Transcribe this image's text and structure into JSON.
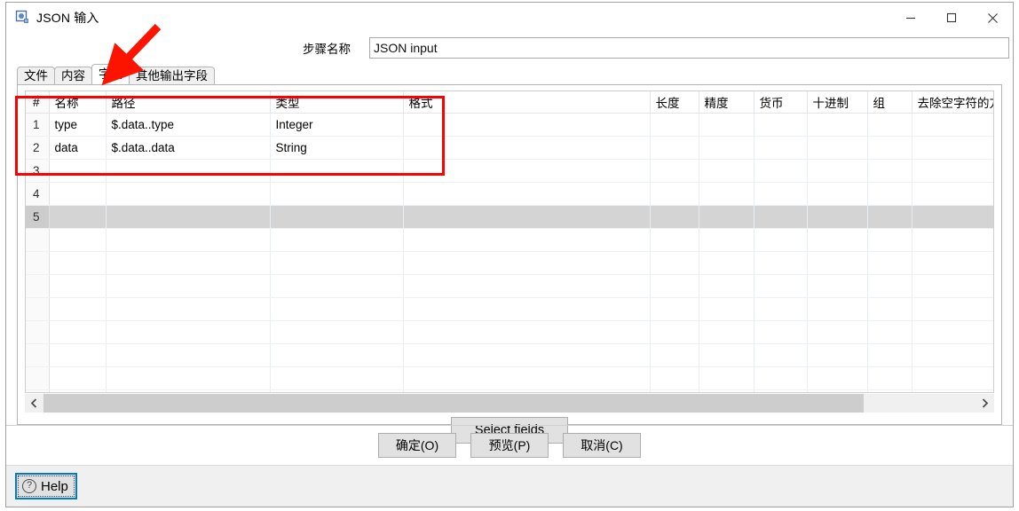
{
  "window": {
    "title": "JSON 输入",
    "icon": "json-input-app-icon",
    "controls": {
      "minimize": "minimize-icon",
      "maximize": "maximize-icon",
      "close": "close-icon"
    }
  },
  "step": {
    "label": "步骤名称",
    "value": "JSON input",
    "placeholder": ""
  },
  "tabs": [
    {
      "label": "文件",
      "active": false
    },
    {
      "label": "内容",
      "active": false
    },
    {
      "label": "字段",
      "active": true
    },
    {
      "label": "其他输出字段",
      "active": false
    }
  ],
  "grid": {
    "columns": [
      {
        "label": "#",
        "key": "idx"
      },
      {
        "label": "名称",
        "key": "name"
      },
      {
        "label": "路径",
        "key": "path"
      },
      {
        "label": "类型",
        "key": "type"
      },
      {
        "label": "格式",
        "key": "format"
      },
      {
        "label": "长度",
        "key": "length"
      },
      {
        "label": "精度",
        "key": "precision"
      },
      {
        "label": "货币",
        "key": "currency"
      },
      {
        "label": "十进制",
        "key": "decimal"
      },
      {
        "label": "组",
        "key": "group"
      },
      {
        "label": "去除空字符的方",
        "key": "trim"
      }
    ],
    "rows": [
      {
        "idx": "1",
        "name": "type",
        "path": "$.data..type",
        "type": "Integer",
        "format": "",
        "length": "",
        "precision": "",
        "currency": "",
        "decimal": "",
        "group": "",
        "trim": "",
        "selected": false
      },
      {
        "idx": "2",
        "name": "data",
        "path": "$.data..data",
        "type": "String",
        "format": "",
        "length": "",
        "precision": "",
        "currency": "",
        "decimal": "",
        "group": "",
        "trim": "",
        "selected": false
      },
      {
        "idx": "3",
        "name": "",
        "path": "",
        "type": "",
        "format": "",
        "length": "",
        "precision": "",
        "currency": "",
        "decimal": "",
        "group": "",
        "trim": "",
        "selected": false
      },
      {
        "idx": "4",
        "name": "",
        "path": "",
        "type": "",
        "format": "",
        "length": "",
        "precision": "",
        "currency": "",
        "decimal": "",
        "group": "",
        "trim": "",
        "selected": false
      },
      {
        "idx": "5",
        "name": "",
        "path": "",
        "type": "",
        "format": "",
        "length": "",
        "precision": "",
        "currency": "",
        "decimal": "",
        "group": "",
        "trim": "",
        "selected": true
      },
      {
        "idx": "",
        "name": "",
        "path": "",
        "type": "",
        "format": "",
        "length": "",
        "precision": "",
        "currency": "",
        "decimal": "",
        "group": "",
        "trim": "",
        "selected": false
      },
      {
        "idx": "",
        "name": "",
        "path": "",
        "type": "",
        "format": "",
        "length": "",
        "precision": "",
        "currency": "",
        "decimal": "",
        "group": "",
        "trim": "",
        "selected": false
      },
      {
        "idx": "",
        "name": "",
        "path": "",
        "type": "",
        "format": "",
        "length": "",
        "precision": "",
        "currency": "",
        "decimal": "",
        "group": "",
        "trim": "",
        "selected": false
      },
      {
        "idx": "",
        "name": "",
        "path": "",
        "type": "",
        "format": "",
        "length": "",
        "precision": "",
        "currency": "",
        "decimal": "",
        "group": "",
        "trim": "",
        "selected": false
      },
      {
        "idx": "",
        "name": "",
        "path": "",
        "type": "",
        "format": "",
        "length": "",
        "precision": "",
        "currency": "",
        "decimal": "",
        "group": "",
        "trim": "",
        "selected": false
      },
      {
        "idx": "",
        "name": "",
        "path": "",
        "type": "",
        "format": "",
        "length": "",
        "precision": "",
        "currency": "",
        "decimal": "",
        "group": "",
        "trim": "",
        "selected": false
      },
      {
        "idx": "",
        "name": "",
        "path": "",
        "type": "",
        "format": "",
        "length": "",
        "precision": "",
        "currency": "",
        "decimal": "",
        "group": "",
        "trim": "",
        "selected": false
      },
      {
        "idx": "",
        "name": "",
        "path": "",
        "type": "",
        "format": "",
        "length": "",
        "precision": "",
        "currency": "",
        "decimal": "",
        "group": "",
        "trim": "",
        "selected": false
      }
    ],
    "sort_indicator": "︿"
  },
  "scrollbar": {
    "left_arrow": "chevron-left-icon",
    "right_arrow": "chevron-right-icon",
    "thumb_percent": 88
  },
  "actions": {
    "select_fields": "Select fields",
    "ok": "确定(O)",
    "preview": "预览(P)",
    "cancel": "取消(C)",
    "help": "Help"
  },
  "annotations": {
    "highlight_color": "#ff0000",
    "arrow_target": "字段 tab"
  }
}
